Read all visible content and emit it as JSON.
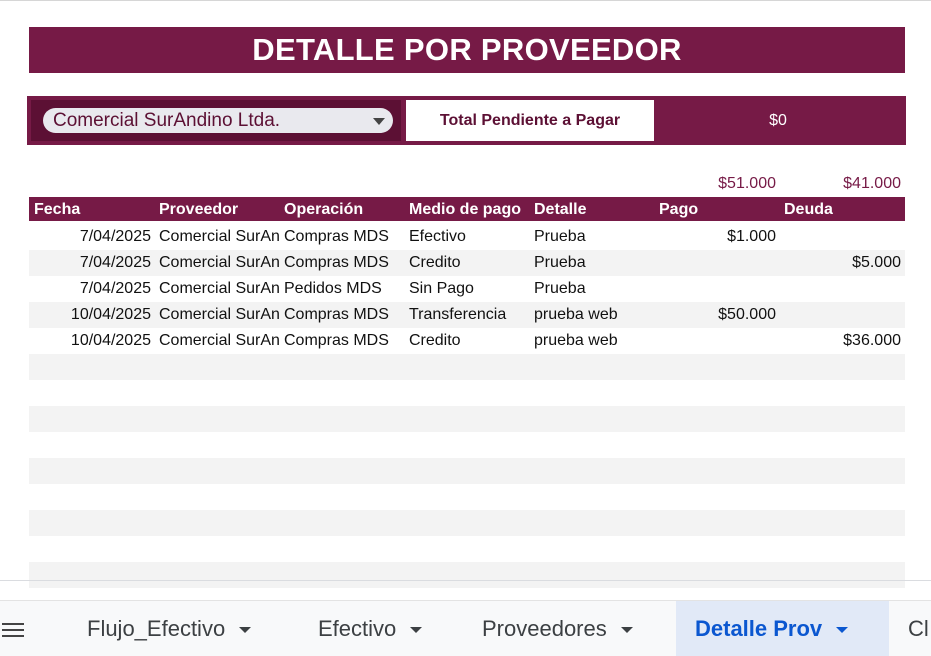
{
  "title": "DETALLE POR PROVEEDOR",
  "filter": {
    "selected_supplier": "Comercial SurAndino Ltda.",
    "total_label": "Total Pendiente a Pagar",
    "total_value": "$0"
  },
  "totals": {
    "pago": "$51.000",
    "deuda": "$41.000"
  },
  "table": {
    "headers": {
      "fecha": "Fecha",
      "proveedor": "Proveedor",
      "operacion": "Operación",
      "medio": "Medio de pago",
      "detalle": "Detalle",
      "pago": "Pago",
      "deuda": "Deuda"
    },
    "rows": [
      [
        "7/04/2025",
        "Comercial SurAn",
        "Compras MDS",
        "Efectivo",
        "Prueba",
        "$1.000",
        ""
      ],
      [
        "7/04/2025",
        "Comercial SurAn",
        "Compras MDS",
        "Credito",
        "Prueba",
        "",
        "$5.000"
      ],
      [
        "7/04/2025",
        "Comercial SurAn",
        "Pedidos MDS",
        "Sin Pago",
        "Prueba",
        "",
        ""
      ],
      [
        "10/04/2025",
        "Comercial SurAn",
        "Compras MDS",
        "Transferencia",
        "prueba web",
        "$50.000",
        ""
      ],
      [
        "10/04/2025",
        "Comercial SurAn",
        "Compras MDS",
        "Credito",
        "prueba web",
        "",
        "$36.000"
      ],
      [
        "",
        "",
        "",
        "",
        "",
        "",
        ""
      ],
      [
        "",
        "",
        "",
        "",
        "",
        "",
        ""
      ],
      [
        "",
        "",
        "",
        "",
        "",
        "",
        ""
      ],
      [
        "",
        "",
        "",
        "",
        "",
        "",
        ""
      ],
      [
        "",
        "",
        "",
        "",
        "",
        "",
        ""
      ],
      [
        "",
        "",
        "",
        "",
        "",
        "",
        ""
      ],
      [
        "",
        "",
        "",
        "",
        "",
        "",
        ""
      ],
      [
        "",
        "",
        "",
        "",
        "",
        "",
        ""
      ],
      [
        "",
        "",
        "",
        "",
        "",
        "",
        ""
      ]
    ]
  },
  "sheet_tabs": [
    {
      "label": "Flujo_Efectivo",
      "active": false
    },
    {
      "label": "Efectivo",
      "active": false
    },
    {
      "label": "Proveedores",
      "active": false
    },
    {
      "label": "Detalle Prov",
      "active": true
    },
    {
      "label": "Cl",
      "active": false
    }
  ],
  "colors": {
    "accent": "#761a46",
    "active_tab": "#0b57d0"
  }
}
